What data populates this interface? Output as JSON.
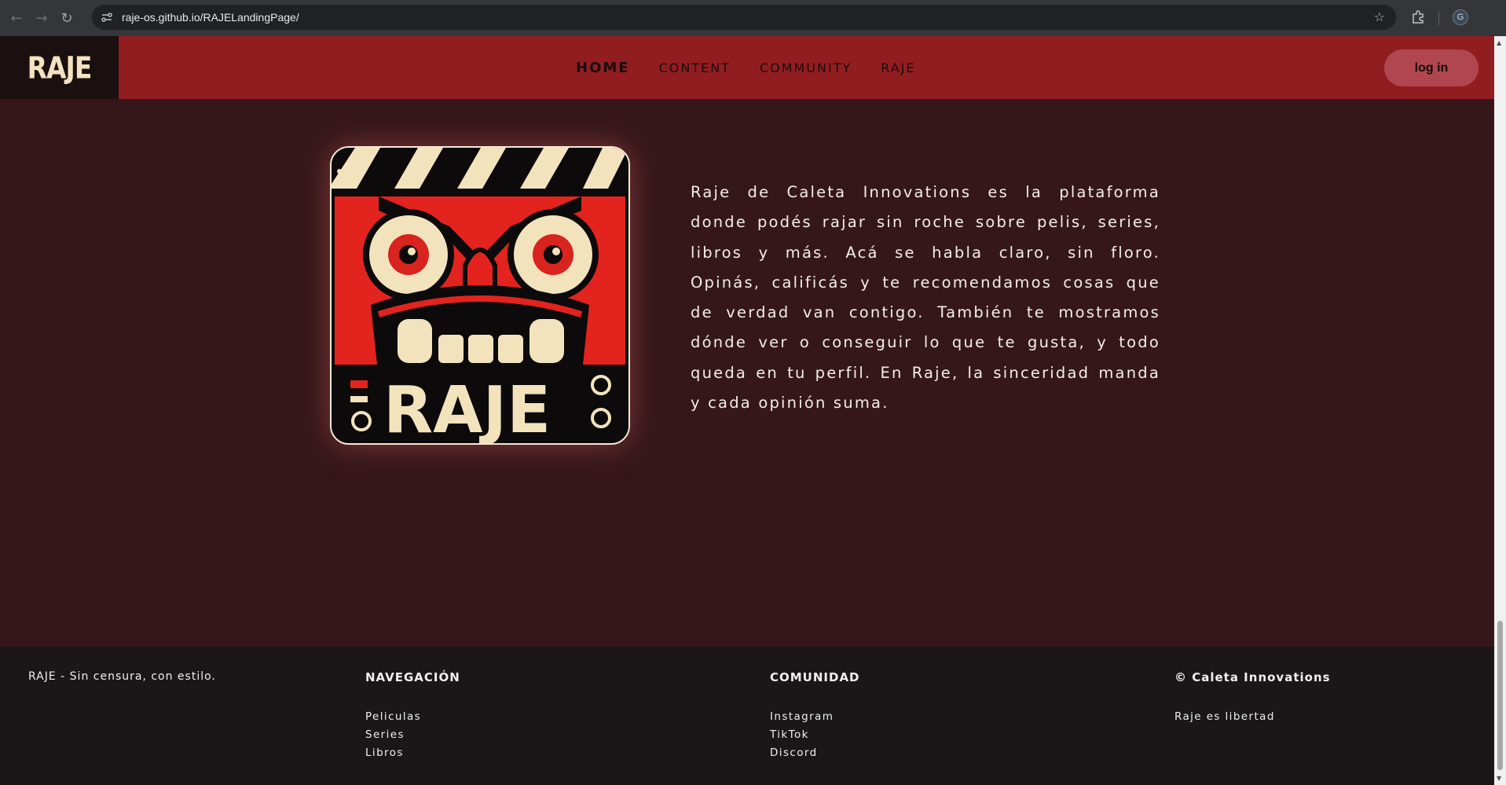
{
  "browser": {
    "url": "raje-os.github.io/RAJELandingPage/",
    "profile_initial": "G"
  },
  "header": {
    "logo": "RAJE",
    "nav": [
      "HOME",
      "CONTENT",
      "COMMUNITY",
      "RAJE"
    ],
    "login_label": "log in"
  },
  "hero": {
    "logo_word": "RAJE",
    "description": "Raje de Caleta Innovations es la plataforma donde podés rajar sin roche sobre pelis, series, libros y más. Acá se habla claro, sin floro. Opinás, calificás y te recomendamos cosas que de verdad van contigo. También te mostramos dónde ver o conseguir lo que te gusta, y todo queda en tu perfil. En Raje, la sinceridad manda y cada opinión suma."
  },
  "footer": {
    "tagline": "RAJE - Sin censura, con estilo.",
    "navegacion": {
      "heading": "NAVEGACIÓN",
      "links": [
        "Peliculas",
        "Series",
        "Libros"
      ]
    },
    "comunidad": {
      "heading": "COMUNIDAD",
      "links": [
        "Instagram",
        "TikTok",
        "Discord"
      ]
    },
    "copyright": {
      "heading": "© Caleta Innovations",
      "text": "Raje es libertad"
    }
  },
  "colors": {
    "header_red": "#921d21",
    "page_bg": "#35171b",
    "footer_bg": "#1b1719",
    "login_button": "#b0464f",
    "logo_cream": "#f4e2c0"
  }
}
